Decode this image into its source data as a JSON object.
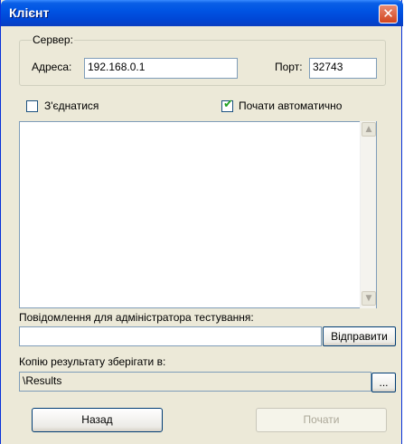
{
  "window": {
    "title": "Клієнт",
    "close_glyph": "✕"
  },
  "server": {
    "group_label": "Сервер:",
    "address_label": "Адреса:",
    "address_value": "192.168.0.1",
    "port_label": "Порт:",
    "port_value": "32743"
  },
  "options": {
    "connect_label": "З'єднатися",
    "connect_checked": false,
    "autostart_label": "Почати автоматично",
    "autostart_checked": true,
    "check_glyph": "✔"
  },
  "log": {
    "text": "",
    "scroll_up_glyph": "▲",
    "scroll_down_glyph": "▼"
  },
  "message": {
    "label": "Повідомлення для адміністратора тестування:",
    "value": "",
    "send_button": "Відправити"
  },
  "results": {
    "label": "Копію результату  зберігати в:",
    "path": "\\Results",
    "browse_button": "..."
  },
  "footer": {
    "back_button": "Назад",
    "start_button": "Почати",
    "start_enabled": false
  }
}
